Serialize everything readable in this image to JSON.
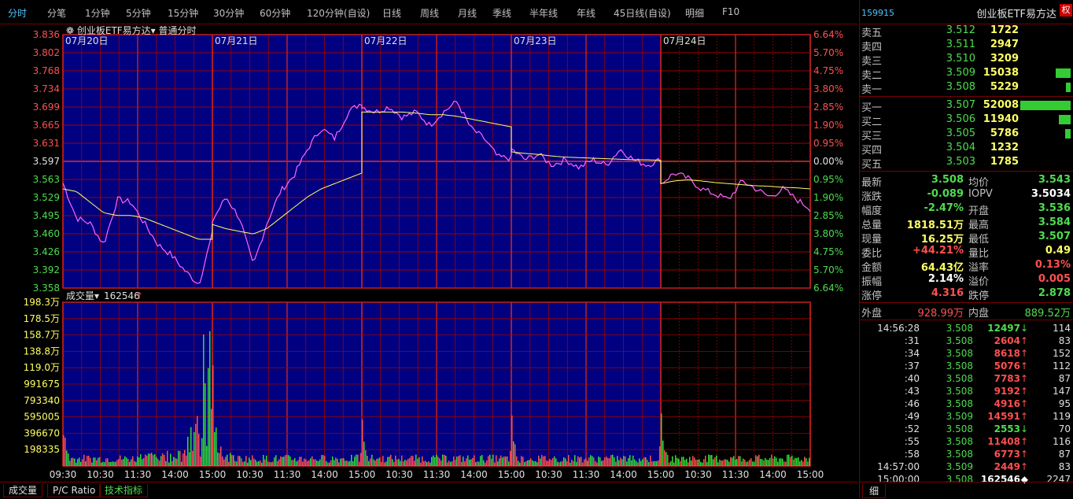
{
  "toolbar": {
    "tabs": [
      "分时",
      "分笔",
      "1分钟",
      "5分钟",
      "15分钟",
      "30分钟",
      "60分钟",
      "120分钟(自设)",
      "日线",
      "周线",
      "月线",
      "季线",
      "半年线",
      "年线",
      "45日线(自设)",
      "明细",
      "F10"
    ],
    "active": "分时"
  },
  "chart": {
    "title": "创业板ETF易方达",
    "mode": "普通分时",
    "days": [
      "07月20日",
      "07月21日",
      "07月22日",
      "07月23日",
      "07月24日"
    ],
    "price_ticks": [
      "3.836",
      "3.802",
      "3.768",
      "3.734",
      "3.699",
      "3.665",
      "3.631",
      "3.597",
      "3.563",
      "3.529",
      "3.495",
      "3.460",
      "3.426",
      "3.392",
      "3.358"
    ],
    "pct_ticks": [
      "6.64%",
      "5.70%",
      "4.75%",
      "3.80%",
      "2.85%",
      "1.90%",
      "0.95%",
      "0.00%",
      "0.95%",
      "1.90%",
      "2.85%",
      "3.80%",
      "4.75%",
      "5.70%",
      "6.64%"
    ],
    "vol_label": "成交量",
    "vol_value": "162546",
    "vol_ticks": [
      "198.3万",
      "178.5万",
      "158.7万",
      "138.8万",
      "119.0万",
      "991675",
      "793340",
      "595005",
      "396670",
      "198335"
    ],
    "time_ticks": [
      "09:30",
      "10:30",
      "11:30",
      "14:00",
      "15:00",
      "10:30",
      "11:30",
      "14:00",
      "15:00",
      "10:30",
      "11:30",
      "14:00",
      "15:00",
      "10:30",
      "11:30",
      "14:00",
      "15:00",
      "10:30",
      "11:30",
      "14:00",
      "15:00"
    ],
    "colors": {
      "bg": "#000080",
      "grid": "#a00000",
      "price": "#ff66ff",
      "avg": "#ffff66",
      "vol_up": "#ff5050",
      "vol_down": "#33dd33"
    }
  },
  "chart_data": {
    "type": "line",
    "title": "创业板ETF易方达",
    "ylim": [
      3.358,
      3.836
    ],
    "base": 3.597,
    "series": [
      {
        "name": "价格",
        "day_points": [
          [
            3.556,
            3.49,
            3.48,
            3.44,
            3.525,
            3.52,
            3.48,
            3.44,
            3.42,
            3.39,
            3.365,
            3.46
          ],
          [
            3.485,
            3.53,
            3.49,
            3.4,
            3.48,
            3.54,
            3.57,
            3.62,
            3.66,
            3.64,
            3.69,
            3.708
          ],
          [
            3.7,
            3.69,
            3.7,
            3.68,
            3.69,
            3.665,
            3.69,
            3.71,
            3.66,
            3.64,
            3.605,
            3.603
          ],
          [
            3.62,
            3.6,
            3.61,
            3.59,
            3.6,
            3.585,
            3.6,
            3.59,
            3.62,
            3.6,
            3.59,
            3.6
          ],
          [
            3.555,
            3.575,
            3.565,
            3.545,
            3.535,
            3.525,
            3.56,
            3.545,
            3.53,
            3.545,
            3.525,
            3.508
          ]
        ]
      },
      {
        "name": "均价",
        "day_points": [
          [
            3.545,
            3.54,
            3.52,
            3.5,
            3.495,
            3.495,
            3.49,
            3.48,
            3.47,
            3.46,
            3.45,
            3.45
          ],
          [
            3.478,
            3.47,
            3.465,
            3.46,
            3.47,
            3.49,
            3.51,
            3.53,
            3.545,
            3.555,
            3.565,
            3.575
          ],
          [
            3.69,
            3.69,
            3.69,
            3.69,
            3.688,
            3.685,
            3.685,
            3.682,
            3.677,
            3.672,
            3.667,
            3.662
          ],
          [
            3.615,
            3.612,
            3.61,
            3.607,
            3.605,
            3.604,
            3.603,
            3.602,
            3.601,
            3.6,
            3.6,
            3.599
          ],
          [
            3.555,
            3.56,
            3.562,
            3.56,
            3.557,
            3.555,
            3.553,
            3.551,
            3.55,
            3.548,
            3.547,
            3.545
          ]
        ]
      }
    ],
    "volume_max": 1983000,
    "volume_spikes": [
      [
        0.0,
        0.18
      ],
      [
        1.78,
        0.25
      ],
      [
        1.88,
        0.92
      ],
      [
        1.95,
        0.97
      ],
      [
        2.0,
        0.6
      ],
      [
        2.05,
        0.2
      ],
      [
        2.2,
        0.12
      ],
      [
        2.4,
        0.1
      ],
      [
        4.0,
        0.3
      ],
      [
        6.0,
        0.3
      ],
      [
        8.0,
        0.3
      ]
    ]
  },
  "orderbook": {
    "code": "159915",
    "name": "创业板ETF易方达",
    "quan": "权",
    "asks": [
      {
        "label": "卖五",
        "price": "3.512",
        "vol": "1722",
        "bar": 0.0
      },
      {
        "label": "卖四",
        "price": "3.511",
        "vol": "2947",
        "bar": 0.0
      },
      {
        "label": "卖三",
        "price": "3.510",
        "vol": "3209",
        "bar": 0.0
      },
      {
        "label": "卖二",
        "price": "3.509",
        "vol": "15038",
        "bar": 0.29
      },
      {
        "label": "卖一",
        "price": "3.508",
        "vol": "5229",
        "bar": 0.1
      }
    ],
    "bids": [
      {
        "label": "买一",
        "price": "3.507",
        "vol": "52008",
        "bar": 1.0
      },
      {
        "label": "买二",
        "price": "3.506",
        "vol": "11940",
        "bar": 0.23
      },
      {
        "label": "买三",
        "price": "3.505",
        "vol": "5786",
        "bar": 0.11
      },
      {
        "label": "买四",
        "price": "3.504",
        "vol": "1232",
        "bar": 0.0
      },
      {
        "label": "买五",
        "price": "3.503",
        "vol": "1785",
        "bar": 0.0
      }
    ]
  },
  "quote": [
    {
      "l1": "最新",
      "v1": "3.508",
      "c1": "#4fdc4f",
      "l2": "均价",
      "v2": "3.543",
      "c2": "#4fdc4f"
    },
    {
      "l1": "涨跌",
      "v1": "-0.089",
      "c1": "#4fdc4f",
      "l2": "IOPV",
      "v2": "3.5034",
      "c2": "#ffffff"
    },
    {
      "l1": "幅度",
      "v1": "-2.47%",
      "c1": "#4fdc4f",
      "l2": "开盘",
      "v2": "3.536",
      "c2": "#4fdc4f"
    },
    {
      "l1": "总量",
      "v1": "1818.51万",
      "c1": "#ffff66",
      "l2": "最高",
      "v2": "3.584",
      "c2": "#4fdc4f"
    },
    {
      "l1": "现量",
      "v1": "16.25万",
      "c1": "#ffff66",
      "l2": "最低",
      "v2": "3.507",
      "c2": "#4fdc4f"
    },
    {
      "l1": "委比",
      "v1": "+44.21%",
      "c1": "#ff5050",
      "l2": "量比",
      "v2": "0.49",
      "c2": "#ffff66"
    },
    {
      "l1": "金额",
      "v1": "64.43亿",
      "c1": "#ffff66",
      "l2": "溢率",
      "v2": "0.13%",
      "c2": "#ff5050"
    },
    {
      "l1": "振幅",
      "v1": "2.14%",
      "c1": "#ffffff",
      "l2": "溢价",
      "v2": "0.005",
      "c2": "#ff5050"
    },
    {
      "l1": "涨停",
      "v1": "4.316",
      "c1": "#ff5050",
      "l2": "跌停",
      "v2": "2.878",
      "c2": "#4fdc4f"
    }
  ],
  "outer": {
    "label": "外盘",
    "value": "928.99万",
    "inner_label": "内盘",
    "inner_value": "889.52万"
  },
  "ticks": [
    {
      "t": "14:56:28",
      "p": "3.508",
      "v": "12497",
      "a": "↓",
      "up": false,
      "n": "114"
    },
    {
      "t": ":31",
      "p": "3.508",
      "v": "2604",
      "a": "↑",
      "up": true,
      "n": "83"
    },
    {
      "t": ":34",
      "p": "3.508",
      "v": "8618",
      "a": "↑",
      "up": true,
      "n": "152"
    },
    {
      "t": ":37",
      "p": "3.508",
      "v": "5076",
      "a": "↑",
      "up": true,
      "n": "112"
    },
    {
      "t": ":40",
      "p": "3.508",
      "v": "7783",
      "a": "↑",
      "up": true,
      "n": "87"
    },
    {
      "t": ":43",
      "p": "3.508",
      "v": "9192",
      "a": "↑",
      "up": true,
      "n": "147"
    },
    {
      "t": ":46",
      "p": "3.508",
      "v": "4916",
      "a": "↑",
      "up": true,
      "n": "95"
    },
    {
      "t": ":49",
      "p": "3.509",
      "v": "14591",
      "a": "↑",
      "up": true,
      "n": "119"
    },
    {
      "t": ":52",
      "p": "3.508",
      "v": "2553",
      "a": "↓",
      "up": false,
      "n": "70"
    },
    {
      "t": ":55",
      "p": "3.508",
      "v": "11408",
      "a": "↑",
      "up": true,
      "n": "116"
    },
    {
      "t": ":58",
      "p": "3.508",
      "v": "6773",
      "a": "↑",
      "up": true,
      "n": "87"
    },
    {
      "t": "14:57:00",
      "p": "3.509",
      "v": "2449",
      "a": "↑",
      "up": true,
      "n": "83"
    },
    {
      "t": "15:00:00",
      "p": "3.508",
      "v": "162546",
      "a": "◆",
      "up": null,
      "n": "2247"
    }
  ],
  "bottom": {
    "tabs": [
      "成交量",
      "P/C Ratio",
      "技术指标"
    ],
    "detail": "细"
  }
}
